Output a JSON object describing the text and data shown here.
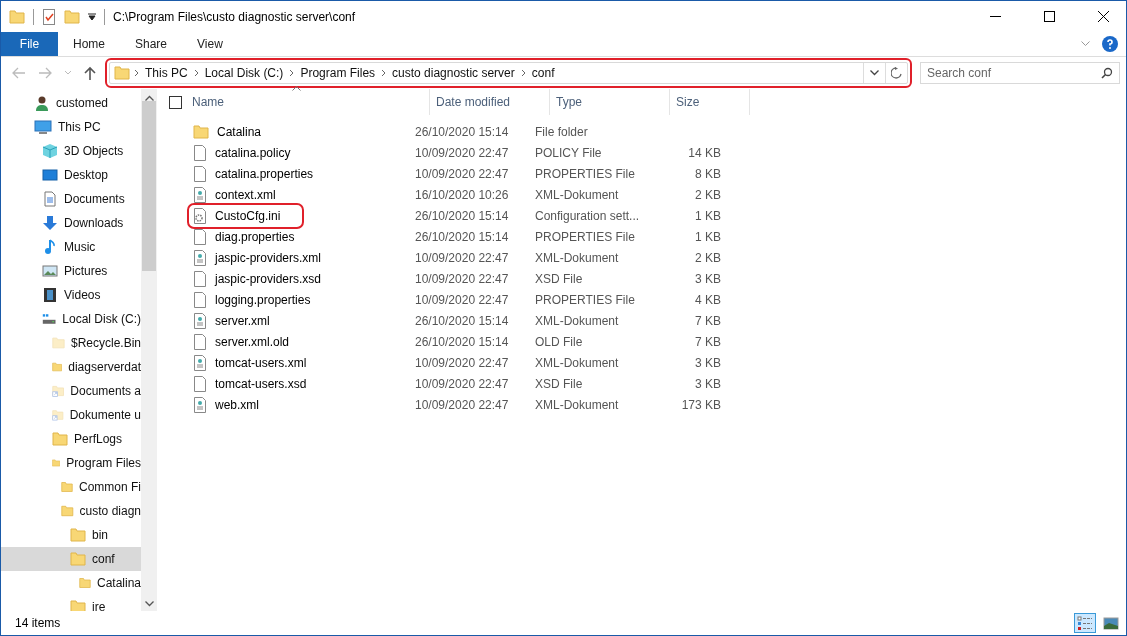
{
  "window": {
    "title": "C:\\Program Files\\custo diagnostic server\\conf"
  },
  "ribbon_tabs": [
    {
      "label": "File",
      "selected": true
    },
    {
      "label": "Home",
      "selected": false
    },
    {
      "label": "Share",
      "selected": false
    },
    {
      "label": "View",
      "selected": false
    }
  ],
  "address_bar": {
    "highlighted": true,
    "crumbs": [
      "This PC",
      "Local Disk (C:)",
      "Program Files",
      "custo diagnostic server",
      "conf"
    ]
  },
  "search": {
    "placeholder": "Search conf"
  },
  "sidebar": {
    "items": [
      {
        "label": "customed",
        "kind": "user",
        "selected": false
      },
      {
        "label": "This PC",
        "kind": "pc",
        "selected": false,
        "children": [
          {
            "label": "3D Objects",
            "kind": "cube",
            "selected": false
          },
          {
            "label": "Desktop",
            "kind": "desktop",
            "selected": false
          },
          {
            "label": "Documents",
            "kind": "documents",
            "selected": false
          },
          {
            "label": "Downloads",
            "kind": "downloads",
            "selected": false
          },
          {
            "label": "Music",
            "kind": "music",
            "selected": false
          },
          {
            "label": "Pictures",
            "kind": "pictures",
            "selected": false
          },
          {
            "label": "Videos",
            "kind": "videos",
            "selected": false
          },
          {
            "label": "Local Disk (C:)",
            "kind": "disk",
            "selected": false,
            "children": [
              {
                "label": "$Recycle.Bin",
                "kind": "hidden-folder",
                "selected": false
              },
              {
                "label": "diagserverdat",
                "kind": "folder",
                "selected": false
              },
              {
                "label": "Documents a",
                "kind": "shortcut-folder",
                "selected": false
              },
              {
                "label": "Dokumente u",
                "kind": "shortcut-folder",
                "selected": false
              },
              {
                "label": "PerfLogs",
                "kind": "folder",
                "selected": false
              },
              {
                "label": "Program Files",
                "kind": "folder",
                "selected": false,
                "children": [
                  {
                    "label": "Common Fi",
                    "kind": "folder",
                    "selected": false
                  },
                  {
                    "label": "custo diagn",
                    "kind": "folder",
                    "selected": false,
                    "children": [
                      {
                        "label": "bin",
                        "kind": "folder",
                        "selected": false
                      },
                      {
                        "label": "conf",
                        "kind": "folder",
                        "selected": true,
                        "children": [
                          {
                            "label": "Catalina",
                            "kind": "folder",
                            "selected": false
                          }
                        ]
                      },
                      {
                        "label": "ire",
                        "kind": "folder",
                        "selected": false
                      }
                    ]
                  }
                ]
              }
            ]
          }
        ]
      }
    ]
  },
  "table": {
    "select_all": {
      "checked": false
    },
    "columns": [
      {
        "label": "Name",
        "sorted": true
      },
      {
        "label": "Date modified",
        "sorted": false
      },
      {
        "label": "Type",
        "sorted": false
      },
      {
        "label": "Size",
        "sorted": false
      }
    ],
    "rows": [
      {
        "kind": "folder",
        "name": "Catalina",
        "date": "26/10/2020 15:14",
        "type": "File folder",
        "size": "",
        "highlighted": false
      },
      {
        "kind": "file",
        "name": "catalina.policy",
        "date": "10/09/2020 22:47",
        "type": "POLICY File",
        "size": "14 KB",
        "highlighted": false
      },
      {
        "kind": "file",
        "name": "catalina.properties",
        "date": "10/09/2020 22:47",
        "type": "PROPERTIES File",
        "size": "8 KB",
        "highlighted": false
      },
      {
        "kind": "xml",
        "name": "context.xml",
        "date": "16/10/2020 10:26",
        "type": "XML-Dokument",
        "size": "2 KB",
        "highlighted": false
      },
      {
        "kind": "ini",
        "name": "CustoCfg.ini",
        "date": "26/10/2020 15:14",
        "type": "Configuration sett...",
        "size": "1 KB",
        "highlighted": true
      },
      {
        "kind": "file",
        "name": "diag.properties",
        "date": "26/10/2020 15:14",
        "type": "PROPERTIES File",
        "size": "1 KB",
        "highlighted": false
      },
      {
        "kind": "xml",
        "name": "jaspic-providers.xml",
        "date": "10/09/2020 22:47",
        "type": "XML-Dokument",
        "size": "2 KB",
        "highlighted": false
      },
      {
        "kind": "file",
        "name": "jaspic-providers.xsd",
        "date": "10/09/2020 22:47",
        "type": "XSD File",
        "size": "3 KB",
        "highlighted": false
      },
      {
        "kind": "file",
        "name": "logging.properties",
        "date": "10/09/2020 22:47",
        "type": "PROPERTIES File",
        "size": "4 KB",
        "highlighted": false
      },
      {
        "kind": "xml",
        "name": "server.xml",
        "date": "26/10/2020 15:14",
        "type": "XML-Dokument",
        "size": "7 KB",
        "highlighted": false
      },
      {
        "kind": "file",
        "name": "server.xml.old",
        "date": "26/10/2020 15:14",
        "type": "OLD File",
        "size": "7 KB",
        "highlighted": false
      },
      {
        "kind": "xml",
        "name": "tomcat-users.xml",
        "date": "10/09/2020 22:47",
        "type": "XML-Dokument",
        "size": "3 KB",
        "highlighted": false
      },
      {
        "kind": "file",
        "name": "tomcat-users.xsd",
        "date": "10/09/2020 22:47",
        "type": "XSD File",
        "size": "3 KB",
        "highlighted": false
      },
      {
        "kind": "xml",
        "name": "web.xml",
        "date": "10/09/2020 22:47",
        "type": "XML-Dokument",
        "size": "173 KB",
        "highlighted": false
      }
    ]
  },
  "status_bar": {
    "text": "14 items",
    "views": [
      {
        "kind": "details",
        "selected": true
      },
      {
        "kind": "large-icons",
        "selected": false
      }
    ]
  }
}
